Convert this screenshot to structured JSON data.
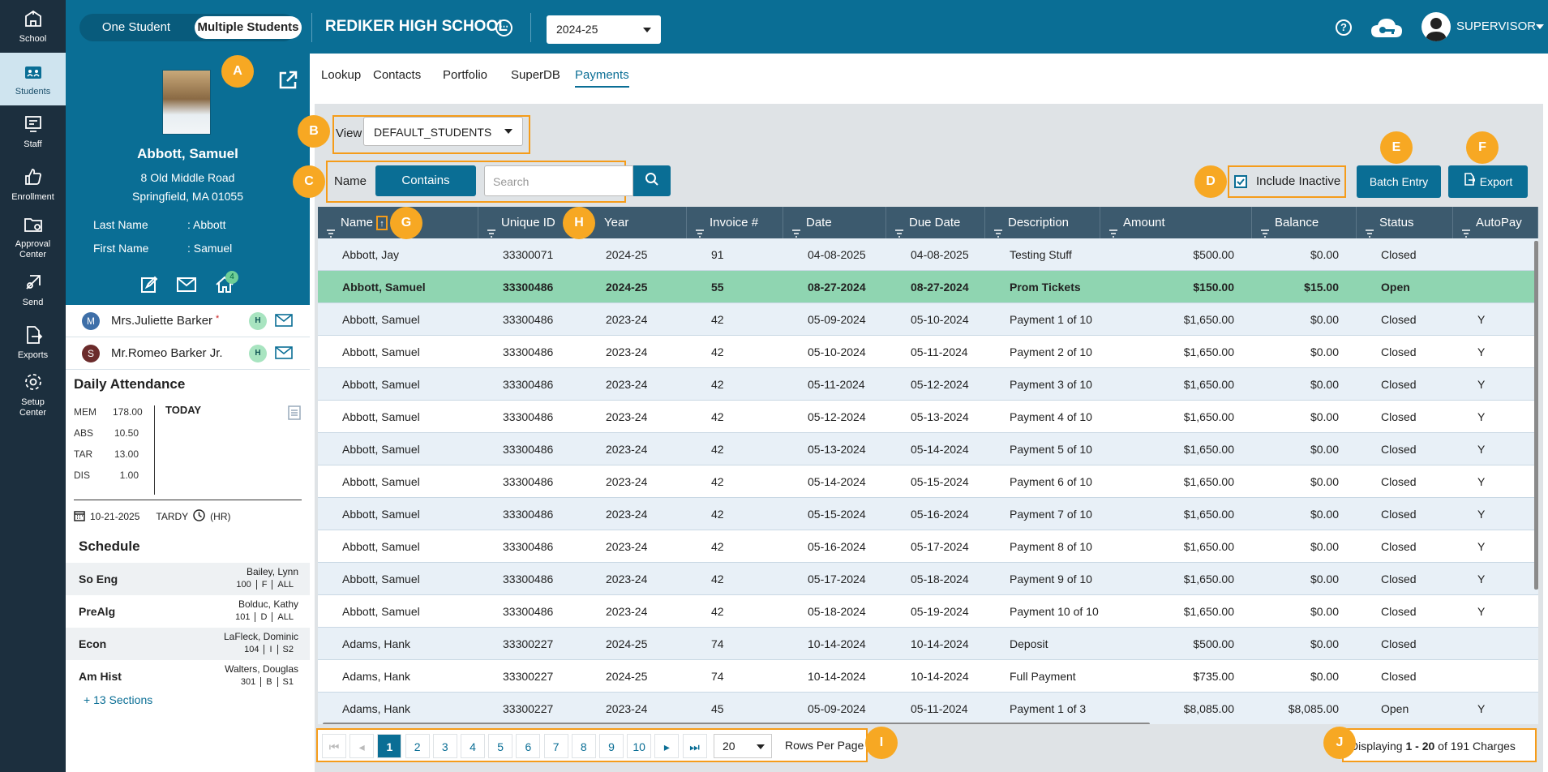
{
  "nav": [
    {
      "label": "School",
      "icon": "school-icon"
    },
    {
      "label": "Students",
      "icon": "students-icon"
    },
    {
      "label": "Staff",
      "icon": "staff-icon"
    },
    {
      "label": "Enrollment",
      "icon": "enrollment-icon"
    },
    {
      "label": "Approval\nCenter",
      "icon": "approval-icon"
    },
    {
      "label": "Send",
      "icon": "send-icon"
    },
    {
      "label": "Exports",
      "icon": "exports-icon"
    },
    {
      "label": "Setup\nCenter",
      "icon": "setup-icon"
    }
  ],
  "topbar": {
    "toggle_one": "One Student",
    "toggle_multi": "Multiple Students",
    "school": "REDIKER HIGH SCHOOL",
    "dots": "⋯",
    "year": "2024-25",
    "help": "?",
    "user": "SUPERVISOR"
  },
  "student": {
    "name": "Abbott, Samuel",
    "addr1": "8 Old Middle Road",
    "addr2": "Springfield, MA 01055",
    "last_label": "Last Name",
    "last_value": ": Abbott",
    "first_label": "First Name",
    "first_value": ": Samuel",
    "home_badge": "4"
  },
  "contacts": [
    {
      "initial": "M",
      "name": "Mrs.Juliette Barker",
      "star": "*",
      "tag": "H",
      "color": "#3e6fa8"
    },
    {
      "initial": "S",
      "name": "Mr.Romeo Barker Jr.",
      "star": "",
      "tag": "H",
      "color": "#6b2b2b"
    }
  ],
  "attendance": {
    "title": "Daily Attendance",
    "rows": [
      {
        "k": "MEM",
        "v": "178.00"
      },
      {
        "k": "ABS",
        "v": "10.50"
      },
      {
        "k": "TAR",
        "v": "13.00"
      },
      {
        "k": "DIS",
        "v": "1.00"
      }
    ],
    "today": "TODAY",
    "date": "10-21-2025",
    "tardy": "TARDY",
    "hr": "(HR)"
  },
  "schedule": {
    "title": "Schedule",
    "rows": [
      {
        "course": "So Eng",
        "teacher": "Bailey, Lynn",
        "room": "100",
        "sem": "F",
        "term": "ALL"
      },
      {
        "course": "PreAlg",
        "teacher": "Bolduc, Kathy",
        "room": "101",
        "sem": "D",
        "term": "ALL"
      },
      {
        "course": "Econ",
        "teacher": "LaFleck, Dominic",
        "room": "104",
        "sem": "I",
        "term": "S2"
      },
      {
        "course": "Am Hist",
        "teacher": "Walters, Douglas",
        "room": "301",
        "sem": "B",
        "term": "S1"
      }
    ],
    "more": "+ 13 Sections"
  },
  "tabs": [
    "Lookup",
    "Contacts",
    "Portfolio",
    "SuperDB",
    "Payments"
  ],
  "view": {
    "label": "View",
    "value": "DEFAULT_STUDENTS"
  },
  "filter": {
    "field": "Name",
    "mode": "Contains",
    "placeholder": "Search"
  },
  "include_inactive": "Include Inactive",
  "batch_entry": "Batch Entry",
  "export": "Export",
  "columns": [
    "Name",
    "Unique ID",
    "Year",
    "Invoice #",
    "Date",
    "Due Date",
    "Description",
    "Amount",
    "Balance",
    "Status",
    "AutoPay"
  ],
  "rows": [
    [
      "Abbott, Jay",
      "33300071",
      "2024-25",
      "91",
      "04-08-2025",
      "04-08-2025",
      "Testing Stuff",
      "$500.00",
      "$0.00",
      "Closed",
      ""
    ],
    [
      "Abbott, Samuel",
      "33300486",
      "2024-25",
      "55",
      "08-27-2024",
      "08-27-2024",
      "Prom Tickets",
      "$150.00",
      "$15.00",
      "Open",
      ""
    ],
    [
      "Abbott, Samuel",
      "33300486",
      "2023-24",
      "42",
      "05-09-2024",
      "05-10-2024",
      "Payment 1 of 10",
      "$1,650.00",
      "$0.00",
      "Closed",
      "Y"
    ],
    [
      "Abbott, Samuel",
      "33300486",
      "2023-24",
      "42",
      "05-10-2024",
      "05-11-2024",
      "Payment 2 of 10",
      "$1,650.00",
      "$0.00",
      "Closed",
      "Y"
    ],
    [
      "Abbott, Samuel",
      "33300486",
      "2023-24",
      "42",
      "05-11-2024",
      "05-12-2024",
      "Payment 3 of 10",
      "$1,650.00",
      "$0.00",
      "Closed",
      "Y"
    ],
    [
      "Abbott, Samuel",
      "33300486",
      "2023-24",
      "42",
      "05-12-2024",
      "05-13-2024",
      "Payment 4 of 10",
      "$1,650.00",
      "$0.00",
      "Closed",
      "Y"
    ],
    [
      "Abbott, Samuel",
      "33300486",
      "2023-24",
      "42",
      "05-13-2024",
      "05-14-2024",
      "Payment 5 of 10",
      "$1,650.00",
      "$0.00",
      "Closed",
      "Y"
    ],
    [
      "Abbott, Samuel",
      "33300486",
      "2023-24",
      "42",
      "05-14-2024",
      "05-15-2024",
      "Payment 6 of 10",
      "$1,650.00",
      "$0.00",
      "Closed",
      "Y"
    ],
    [
      "Abbott, Samuel",
      "33300486",
      "2023-24",
      "42",
      "05-15-2024",
      "05-16-2024",
      "Payment 7 of 10",
      "$1,650.00",
      "$0.00",
      "Closed",
      "Y"
    ],
    [
      "Abbott, Samuel",
      "33300486",
      "2023-24",
      "42",
      "05-16-2024",
      "05-17-2024",
      "Payment 8 of 10",
      "$1,650.00",
      "$0.00",
      "Closed",
      "Y"
    ],
    [
      "Abbott, Samuel",
      "33300486",
      "2023-24",
      "42",
      "05-17-2024",
      "05-18-2024",
      "Payment 9 of 10",
      "$1,650.00",
      "$0.00",
      "Closed",
      "Y"
    ],
    [
      "Abbott, Samuel",
      "33300486",
      "2023-24",
      "42",
      "05-18-2024",
      "05-19-2024",
      "Payment 10 of 10",
      "$1,650.00",
      "$0.00",
      "Closed",
      "Y"
    ],
    [
      "Adams, Hank",
      "33300227",
      "2024-25",
      "74",
      "10-14-2024",
      "10-14-2024",
      "Deposit",
      "$500.00",
      "$0.00",
      "Closed",
      ""
    ],
    [
      "Adams, Hank",
      "33300227",
      "2024-25",
      "74",
      "10-14-2024",
      "10-14-2024",
      "Full Payment",
      "$735.00",
      "$0.00",
      "Closed",
      ""
    ],
    [
      "Adams, Hank",
      "33300227",
      "2023-24",
      "45",
      "05-09-2024",
      "05-11-2024",
      "Payment 1 of 3",
      "$8,085.00",
      "$8,085.00",
      "Open",
      "Y"
    ]
  ],
  "selected_row": 1,
  "pager": {
    "first": "⏮",
    "prev": "◂",
    "pages": [
      "1",
      "2",
      "3",
      "4",
      "5",
      "6",
      "7",
      "8",
      "9",
      "10"
    ],
    "next": "▸",
    "last": "⏭",
    "rows_per_page": "20",
    "rows_label": "Rows Per Page",
    "display_prefix": "Displaying ",
    "display_range": "1 - 20",
    "display_suffix": " of 191 Charges"
  },
  "callouts": [
    "A",
    "B",
    "C",
    "D",
    "E",
    "F",
    "G",
    "H",
    "I",
    "J"
  ],
  "colors": {
    "brand": "#0a6e95",
    "nav": "#1c2f3e",
    "header": "#3c5a6e",
    "selected": "#8fd5b1",
    "callout": "#f7a823"
  }
}
